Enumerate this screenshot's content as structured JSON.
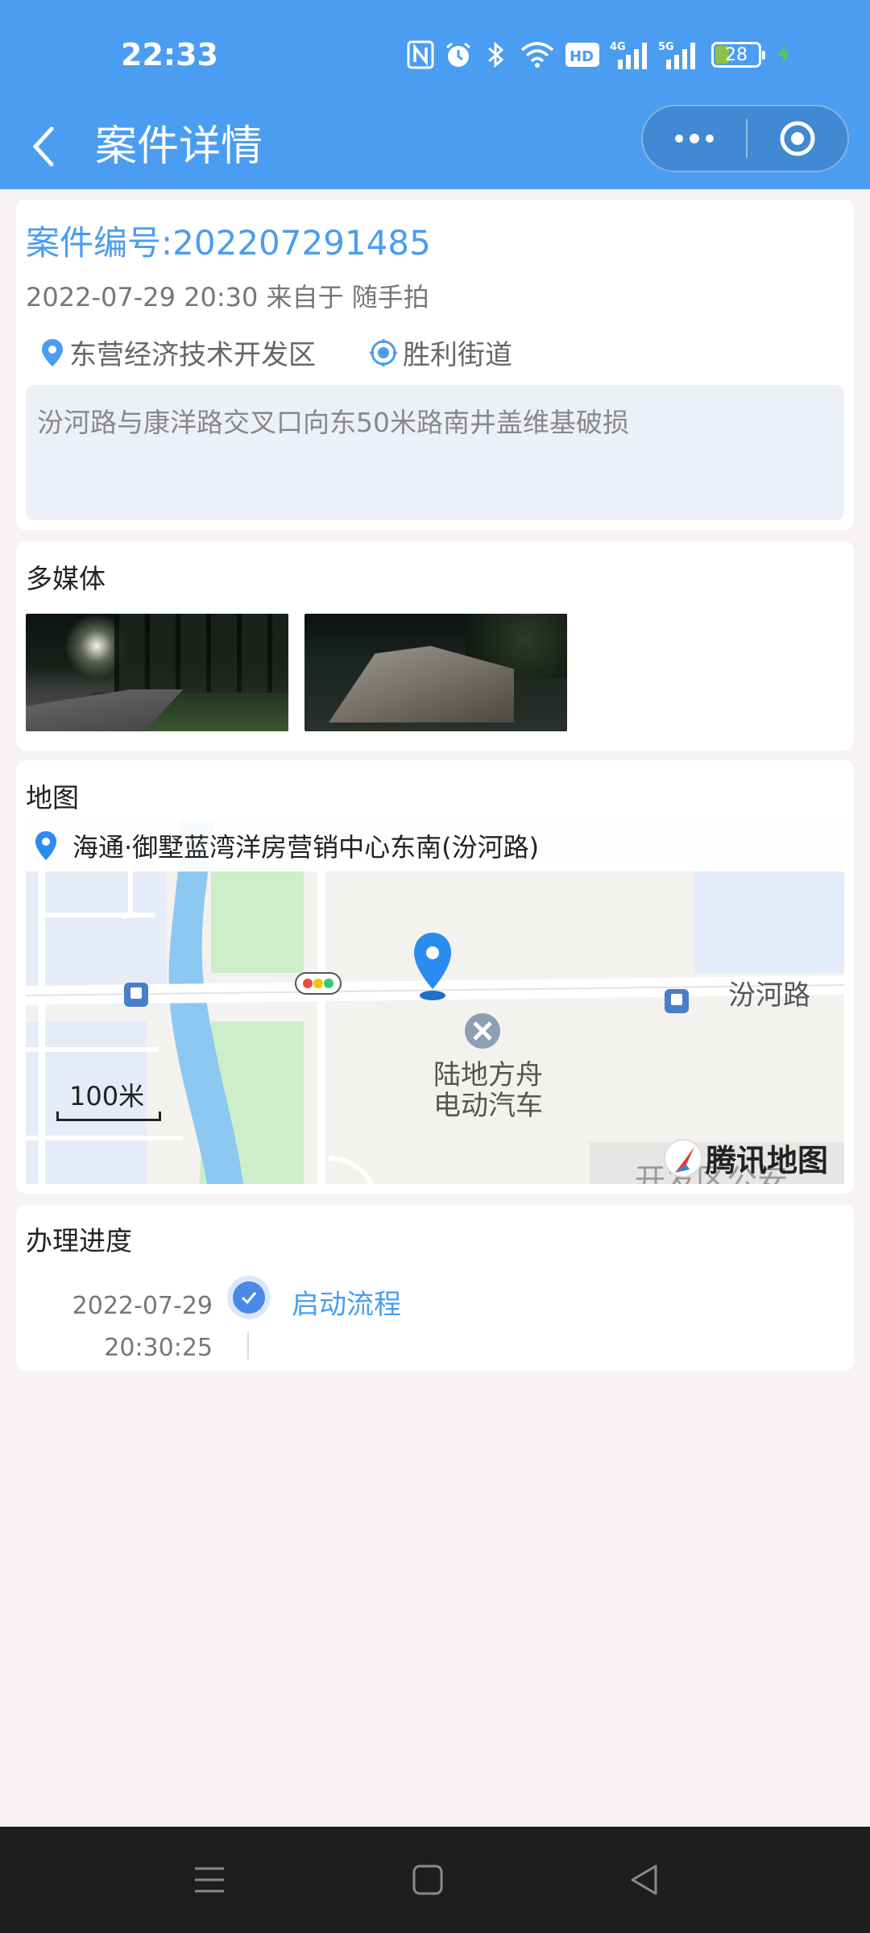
{
  "status_bar": {
    "time": "22:33",
    "battery_level": "28",
    "icons": [
      "nfc-icon",
      "alarm-icon",
      "bluetooth-icon",
      "wifi-icon",
      "hd-icon",
      "signal-4g-icon",
      "signal-5g-icon",
      "battery-icon",
      "charging-icon"
    ]
  },
  "nav": {
    "title": "案件详情"
  },
  "case": {
    "number": "案件编号:202207291485",
    "meta": "2022-07-29 20:30 来自于 随手拍",
    "district": "东营经济技术开发区",
    "street": "胜利街道",
    "description": "汾河路与康洋路交叉口向东50米路南井盖维基破损"
  },
  "media": {
    "title": "多媒体"
  },
  "map": {
    "title": "地图",
    "address": "海通·御墅蓝湾洋房营销中心东南(汾河路)",
    "scale": "100米",
    "street_label": "汾河路",
    "poi_label_line1": "陆地方舟",
    "poi_label_line2": "电动汽车",
    "logo_text": "腾讯地图",
    "cut_label": "开发区公安"
  },
  "progress": {
    "title": "办理进度",
    "date": "2022-07-29",
    "time": "20:30:25",
    "step": "启动流程"
  },
  "colors": {
    "header": "#4a9df0",
    "accent": "#4a9df0",
    "page_bg": "#f7f2f6"
  }
}
